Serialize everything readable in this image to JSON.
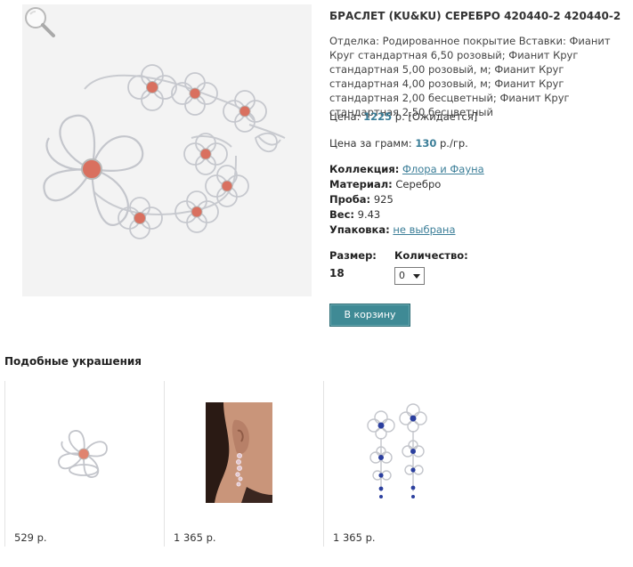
{
  "product": {
    "title": "БРАСЛЕТ (KU&KU) СЕРЕБРО 420440-2 420440-2",
    "description": "Отделка: Родированное покрытие Вставки: Фианит Круг стандартная 6,50 розовый; Фианит Круг стандартная 5,00 розовый, м; Фианит Круг стандартная 4,00 розовый, м; Фианит Круг стандартная 2,00 бесцветный; Фианит Круг стандартная 2,50 бесцветный",
    "price_label": "Цена:",
    "price_value": "1225",
    "price_suffix": " р. [Ожидается]",
    "ppg_label": "Цена за грамм:",
    "ppg_value": "130",
    "ppg_suffix": " р./гр.",
    "collection_label": "Коллекция:",
    "collection_value": "Флора и Фауна",
    "material_label": "Материал:",
    "material_value": "Серебро",
    "probe_label": "Проба:",
    "probe_value": "925",
    "weight_label": "Вес:",
    "weight_value": "9.43",
    "packaging_label": "Упаковка:",
    "packaging_value": "не выбрана",
    "size_label": "Размер:",
    "size_value": "18",
    "qty_label": "Количество:",
    "qty_value": "0",
    "cart_button": "В корзину"
  },
  "similar": {
    "title": "Подобные украшения",
    "items": [
      {
        "price": "529 р.",
        "thumb": "flower-ring"
      },
      {
        "price": "1 365 р.",
        "thumb": "earring-on-model"
      },
      {
        "price": "1 365 р.",
        "thumb": "blue-stone-earrings"
      }
    ]
  },
  "colors": {
    "accent": "#3b7e98",
    "button": "#3f8a95",
    "stone_pink": "#d9705f",
    "stone_blue": "#2b3f9e"
  }
}
